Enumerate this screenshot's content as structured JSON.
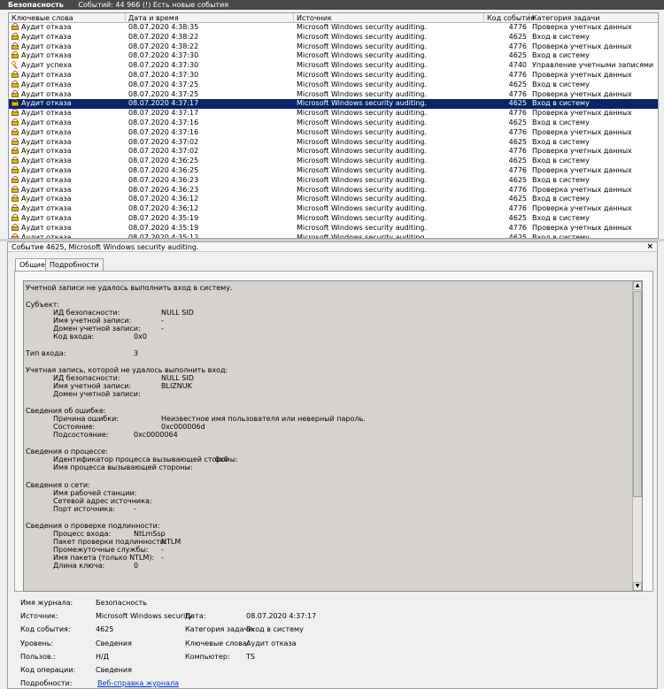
{
  "titlebar": {
    "title": "Безопасность",
    "info": "Событий: 44 966 (!) Есть новые события"
  },
  "grid": {
    "columns": [
      "Ключевые слова",
      "Дата и время",
      "Источник",
      "Код события",
      "Категория задачи"
    ],
    "rows": [
      {
        "icon": "lock-icon",
        "kw": "Аудит отказа",
        "date": "08.07.2020 4:38:35",
        "src": "Microsoft Windows security auditing.",
        "id": "4776",
        "cat": "Проверка учетных данных"
      },
      {
        "icon": "lock-icon",
        "kw": "Аудит отказа",
        "date": "08.07.2020 4:38:22",
        "src": "Microsoft Windows security auditing.",
        "id": "4625",
        "cat": "Вход в систему"
      },
      {
        "icon": "lock-icon",
        "kw": "Аудит отказа",
        "date": "08.07.2020 4:38:22",
        "src": "Microsoft Windows security auditing.",
        "id": "4776",
        "cat": "Проверка учетных данных"
      },
      {
        "icon": "lock-icon",
        "kw": "Аудит отказа",
        "date": "08.07.2020 4:37:30",
        "src": "Microsoft Windows security auditing.",
        "id": "4625",
        "cat": "Вход в систему"
      },
      {
        "icon": "key-icon",
        "kw": "Аудит успеха",
        "date": "08.07.2020 4:37:30",
        "src": "Microsoft Windows security auditing.",
        "id": "4740",
        "cat": "Управление учетными записями"
      },
      {
        "icon": "lock-icon",
        "kw": "Аудит отказа",
        "date": "08.07.2020 4:37:30",
        "src": "Microsoft Windows security auditing.",
        "id": "4776",
        "cat": "Проверка учетных данных"
      },
      {
        "icon": "lock-icon",
        "kw": "Аудит отказа",
        "date": "08.07.2020 4:37:25",
        "src": "Microsoft Windows security auditing.",
        "id": "4625",
        "cat": "Вход в систему"
      },
      {
        "icon": "lock-icon",
        "kw": "Аудит отказа",
        "date": "08.07.2020 4:37:25",
        "src": "Microsoft Windows security auditing.",
        "id": "4776",
        "cat": "Проверка учетных данных"
      },
      {
        "icon": "lock-icon",
        "kw": "Аудит отказа",
        "date": "08.07.2020 4:37:17",
        "src": "Microsoft Windows security auditing.",
        "id": "4625",
        "cat": "Вход в систему",
        "selected": true
      },
      {
        "icon": "lock-icon",
        "kw": "Аудит отказа",
        "date": "08.07.2020 4:37:17",
        "src": "Microsoft Windows security auditing.",
        "id": "4776",
        "cat": "Проверка учетных данных"
      },
      {
        "icon": "lock-icon",
        "kw": "Аудит отказа",
        "date": "08.07.2020 4:37:16",
        "src": "Microsoft Windows security auditing.",
        "id": "4625",
        "cat": "Вход в систему"
      },
      {
        "icon": "lock-icon",
        "kw": "Аудит отказа",
        "date": "08.07.2020 4:37:16",
        "src": "Microsoft Windows security auditing.",
        "id": "4776",
        "cat": "Проверка учетных данных"
      },
      {
        "icon": "lock-icon",
        "kw": "Аудит отказа",
        "date": "08.07.2020 4:37:02",
        "src": "Microsoft Windows security auditing.",
        "id": "4625",
        "cat": "Вход в систему"
      },
      {
        "icon": "lock-icon",
        "kw": "Аудит отказа",
        "date": "08.07.2020 4:37:02",
        "src": "Microsoft Windows security auditing.",
        "id": "4776",
        "cat": "Проверка учетных данных"
      },
      {
        "icon": "lock-icon",
        "kw": "Аудит отказа",
        "date": "08.07.2020 4:36:25",
        "src": "Microsoft Windows security auditing.",
        "id": "4625",
        "cat": "Вход в систему"
      },
      {
        "icon": "lock-icon",
        "kw": "Аудит отказа",
        "date": "08.07.2020 4:36:25",
        "src": "Microsoft Windows security auditing.",
        "id": "4776",
        "cat": "Проверка учетных данных"
      },
      {
        "icon": "lock-icon",
        "kw": "Аудит отказа",
        "date": "08.07.2020 4:36:23",
        "src": "Microsoft Windows security auditing.",
        "id": "4625",
        "cat": "Вход в систему"
      },
      {
        "icon": "lock-icon",
        "kw": "Аудит отказа",
        "date": "08.07.2020 4:36:23",
        "src": "Microsoft Windows security auditing.",
        "id": "4776",
        "cat": "Проверка учетных данных"
      },
      {
        "icon": "lock-icon",
        "kw": "Аудит отказа",
        "date": "08.07.2020 4:36:12",
        "src": "Microsoft Windows security auditing.",
        "id": "4625",
        "cat": "Вход в систему"
      },
      {
        "icon": "lock-icon",
        "kw": "Аудит отказа",
        "date": "08.07.2020 4:36:12",
        "src": "Microsoft Windows security auditing.",
        "id": "4776",
        "cat": "Проверка учетных данных"
      },
      {
        "icon": "lock-icon",
        "kw": "Аудит отказа",
        "date": "08.07.2020 4:35:19",
        "src": "Microsoft Windows security auditing.",
        "id": "4625",
        "cat": "Вход в систему"
      },
      {
        "icon": "lock-icon",
        "kw": "Аудит отказа",
        "date": "08.07.2020 4:35:19",
        "src": "Microsoft Windows security auditing.",
        "id": "4776",
        "cat": "Проверка учетных данных"
      },
      {
        "icon": "lock-icon",
        "kw": "Аудит отказа",
        "date": "08.07.2020 4:35:12",
        "src": "Microsoft Windows security auditing.",
        "id": "4625",
        "cat": "Вход в систему"
      }
    ]
  },
  "detail": {
    "title": "Событие 4625, Microsoft Windows security auditing.",
    "close": "×",
    "tabs": [
      "Общие",
      "Подробности"
    ],
    "message": {
      "headline": "Учетной записи не удалось выполнить вход в систему.",
      "subject_header": "Субъект:",
      "subject": [
        {
          "label": "ИД безопасности:",
          "value": "NULL SID"
        },
        {
          "label": "Имя учетной записи:",
          "value": "-"
        },
        {
          "label": "Домен учетной записи:",
          "value": "-"
        },
        {
          "label": "Код входа:",
          "value": "0x0"
        }
      ],
      "logon_type_label": "Тип входа:",
      "logon_type_value": "3",
      "failed_header": "Учетная запись, которой не удалось выполнить вход:",
      "failed": [
        {
          "label": "ИД безопасности:",
          "value": "NULL SID"
        },
        {
          "label": "Имя учетной записи:",
          "value": "BLIZNUK"
        },
        {
          "label": "Домен учетной записи:",
          "value": ""
        }
      ],
      "error_header": "Сведения об ошибке:",
      "error": [
        {
          "label": "Причина ошибки:",
          "value": "Неизвестное имя пользователя или неверный пароль."
        },
        {
          "label": "Состояние:",
          "value": "0xc000006d"
        },
        {
          "label": "Подсостояние:",
          "value": "0xc0000064"
        }
      ],
      "process_header": "Сведения о процессе:",
      "process": [
        {
          "label": "Идентификатор процесса вызывающей стороны:",
          "value": "0x0"
        },
        {
          "label": "Имя процесса вызывающей стороны:",
          "value": "-"
        }
      ],
      "network_header": "Сведения о сети:",
      "network": [
        {
          "label": "Имя рабочей станции:",
          "value": ""
        },
        {
          "label": "Сетевой адрес источника:",
          "value": "-"
        },
        {
          "label": "Порт источника:",
          "value": "-"
        }
      ],
      "auth_header": "Сведения о проверке подлинности:",
      "auth": [
        {
          "label": "Процесс входа:",
          "value": "NtLmSsp"
        },
        {
          "label": "Пакет проверки подлинности:",
          "value": "NTLM"
        },
        {
          "label": "Промежуточные службы:",
          "value": "-"
        },
        {
          "label": "Имя пакета (только NTLM):",
          "value": "-"
        },
        {
          "label": "Длина ключа:",
          "value": "0"
        }
      ]
    },
    "props": {
      "log_label": "Имя журнала:",
      "log_value": "Безопасность",
      "source_label": "Источник:",
      "source_value": "Microsoft Windows security",
      "date_label": "Дата:",
      "date_value": "08.07.2020 4:37:17",
      "event_id_label": "Код события:",
      "event_id_value": "4625",
      "task_label": "Категория задачи:",
      "task_value": "Вход в систему",
      "level_label": "Уровень:",
      "level_value": "Сведения",
      "keywords_label": "Ключевые слова:",
      "keywords_value": "Аудит отказа",
      "user_label": "Пользов.:",
      "user_value": "Н/Д",
      "computer_label": "Компьютер:",
      "computer_value": "TS",
      "opcode_label": "Код операции:",
      "opcode_value": "Сведения",
      "more_label": "Подробности:",
      "more_link": "Веб-справка журнала"
    }
  }
}
